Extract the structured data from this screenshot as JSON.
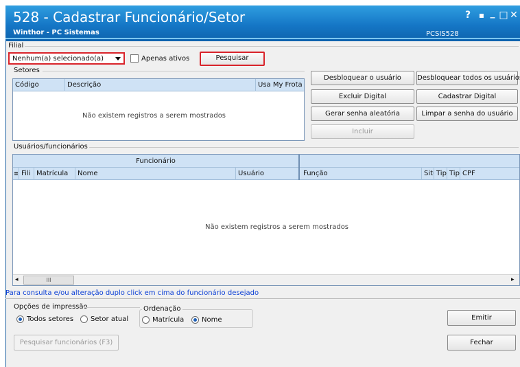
{
  "window": {
    "title": "528 - Cadastrar Funcionário/Setor",
    "subtitle": "Winthor - PC Sistemas",
    "code": "PCSIS528",
    "controls": {
      "help": "?",
      "restore": "▪",
      "minimize": "_",
      "maximize": "□",
      "close": "✕"
    }
  },
  "filial": {
    "label": "Filial",
    "selected": "Nenhum(a) selecionado(a)",
    "apenas_ativos": {
      "label": "Apenas ativos",
      "checked": false
    },
    "pesquisar": "Pesquisar"
  },
  "setores": {
    "label": "Setores",
    "columns": [
      "Código",
      "Descrição",
      "Usa My Frota"
    ],
    "empty_message": "Não existem registros a serem mostrados"
  },
  "actions": {
    "desbloquear_usuario": "Desbloquear o usuário",
    "desbloquear_todos": "Desbloquear todos os usuários",
    "excluir_digital": "Excluir Digital",
    "cadastrar_digital": "Cadastrar Digital",
    "gerar_senha": "Gerar senha aleatória",
    "limpar_senha": "Limpar a senha do usuário",
    "incluir": "Incluir"
  },
  "usuarios": {
    "label": "Usuários/funcionários",
    "group_header": "Funcionário",
    "columns": [
      "Fili",
      "Matrícula",
      "Nome",
      "Usuário",
      "Função",
      "Situ",
      "Tip",
      "Tip",
      "CPF"
    ],
    "empty_message": "Não existem registros a serem mostrados",
    "scroll_grip": "III"
  },
  "hint": "Para consulta e/ou alteração duplo click em cima do funcionário desejado",
  "impressao": {
    "label": "Opções de impressão",
    "options": [
      {
        "label": "Todos setores",
        "selected": true
      },
      {
        "label": "Setor atual",
        "selected": false
      }
    ]
  },
  "ordenacao": {
    "label": "Ordenação",
    "options": [
      {
        "label": "Matrícula",
        "selected": false
      },
      {
        "label": "Nome",
        "selected": true
      }
    ]
  },
  "buttons": {
    "emitir": "Emitir",
    "pesquisar_funcionarios": "Pesquisar funcionários (F3)",
    "fechar": "Fechar"
  },
  "colors": {
    "titlebar": "#1577c6",
    "accent_red": "#d9232a",
    "grid_header": "#cfe2f5",
    "link": "#0b3fd6"
  }
}
